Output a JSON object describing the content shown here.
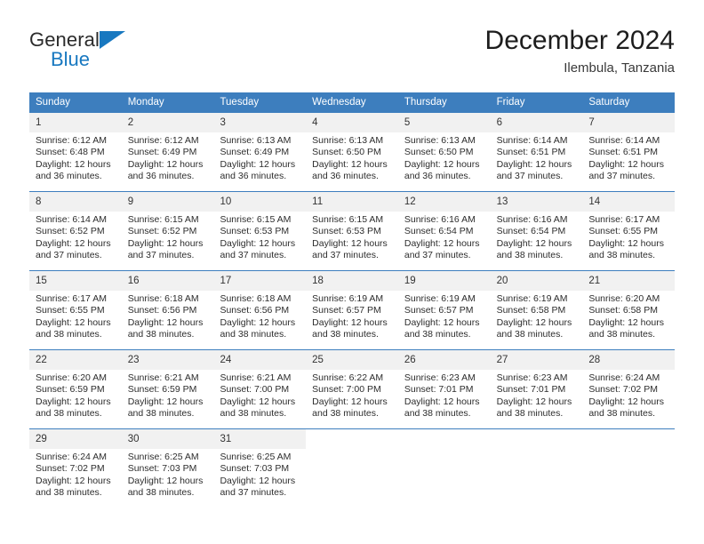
{
  "brand": {
    "name_part1": "General",
    "name_part2": "Blue",
    "accent_color": "#1878c0"
  },
  "header": {
    "title": "December 2024",
    "subtitle": "Ilembula, Tanzania"
  },
  "calendar": {
    "header_color": "#3d7ebe",
    "weekdays": [
      "Sunday",
      "Monday",
      "Tuesday",
      "Wednesday",
      "Thursday",
      "Friday",
      "Saturday"
    ],
    "weeks": [
      [
        {
          "day": "1",
          "sunrise": "Sunrise: 6:12 AM",
          "sunset": "Sunset: 6:48 PM",
          "daylight_line1": "Daylight: 12 hours",
          "daylight_line2": "and 36 minutes."
        },
        {
          "day": "2",
          "sunrise": "Sunrise: 6:12 AM",
          "sunset": "Sunset: 6:49 PM",
          "daylight_line1": "Daylight: 12 hours",
          "daylight_line2": "and 36 minutes."
        },
        {
          "day": "3",
          "sunrise": "Sunrise: 6:13 AM",
          "sunset": "Sunset: 6:49 PM",
          "daylight_line1": "Daylight: 12 hours",
          "daylight_line2": "and 36 minutes."
        },
        {
          "day": "4",
          "sunrise": "Sunrise: 6:13 AM",
          "sunset": "Sunset: 6:50 PM",
          "daylight_line1": "Daylight: 12 hours",
          "daylight_line2": "and 36 minutes."
        },
        {
          "day": "5",
          "sunrise": "Sunrise: 6:13 AM",
          "sunset": "Sunset: 6:50 PM",
          "daylight_line1": "Daylight: 12 hours",
          "daylight_line2": "and 36 minutes."
        },
        {
          "day": "6",
          "sunrise": "Sunrise: 6:14 AM",
          "sunset": "Sunset: 6:51 PM",
          "daylight_line1": "Daylight: 12 hours",
          "daylight_line2": "and 37 minutes."
        },
        {
          "day": "7",
          "sunrise": "Sunrise: 6:14 AM",
          "sunset": "Sunset: 6:51 PM",
          "daylight_line1": "Daylight: 12 hours",
          "daylight_line2": "and 37 minutes."
        }
      ],
      [
        {
          "day": "8",
          "sunrise": "Sunrise: 6:14 AM",
          "sunset": "Sunset: 6:52 PM",
          "daylight_line1": "Daylight: 12 hours",
          "daylight_line2": "and 37 minutes."
        },
        {
          "day": "9",
          "sunrise": "Sunrise: 6:15 AM",
          "sunset": "Sunset: 6:52 PM",
          "daylight_line1": "Daylight: 12 hours",
          "daylight_line2": "and 37 minutes."
        },
        {
          "day": "10",
          "sunrise": "Sunrise: 6:15 AM",
          "sunset": "Sunset: 6:53 PM",
          "daylight_line1": "Daylight: 12 hours",
          "daylight_line2": "and 37 minutes."
        },
        {
          "day": "11",
          "sunrise": "Sunrise: 6:15 AM",
          "sunset": "Sunset: 6:53 PM",
          "daylight_line1": "Daylight: 12 hours",
          "daylight_line2": "and 37 minutes."
        },
        {
          "day": "12",
          "sunrise": "Sunrise: 6:16 AM",
          "sunset": "Sunset: 6:54 PM",
          "daylight_line1": "Daylight: 12 hours",
          "daylight_line2": "and 37 minutes."
        },
        {
          "day": "13",
          "sunrise": "Sunrise: 6:16 AM",
          "sunset": "Sunset: 6:54 PM",
          "daylight_line1": "Daylight: 12 hours",
          "daylight_line2": "and 38 minutes."
        },
        {
          "day": "14",
          "sunrise": "Sunrise: 6:17 AM",
          "sunset": "Sunset: 6:55 PM",
          "daylight_line1": "Daylight: 12 hours",
          "daylight_line2": "and 38 minutes."
        }
      ],
      [
        {
          "day": "15",
          "sunrise": "Sunrise: 6:17 AM",
          "sunset": "Sunset: 6:55 PM",
          "daylight_line1": "Daylight: 12 hours",
          "daylight_line2": "and 38 minutes."
        },
        {
          "day": "16",
          "sunrise": "Sunrise: 6:18 AM",
          "sunset": "Sunset: 6:56 PM",
          "daylight_line1": "Daylight: 12 hours",
          "daylight_line2": "and 38 minutes."
        },
        {
          "day": "17",
          "sunrise": "Sunrise: 6:18 AM",
          "sunset": "Sunset: 6:56 PM",
          "daylight_line1": "Daylight: 12 hours",
          "daylight_line2": "and 38 minutes."
        },
        {
          "day": "18",
          "sunrise": "Sunrise: 6:19 AM",
          "sunset": "Sunset: 6:57 PM",
          "daylight_line1": "Daylight: 12 hours",
          "daylight_line2": "and 38 minutes."
        },
        {
          "day": "19",
          "sunrise": "Sunrise: 6:19 AM",
          "sunset": "Sunset: 6:57 PM",
          "daylight_line1": "Daylight: 12 hours",
          "daylight_line2": "and 38 minutes."
        },
        {
          "day": "20",
          "sunrise": "Sunrise: 6:19 AM",
          "sunset": "Sunset: 6:58 PM",
          "daylight_line1": "Daylight: 12 hours",
          "daylight_line2": "and 38 minutes."
        },
        {
          "day": "21",
          "sunrise": "Sunrise: 6:20 AM",
          "sunset": "Sunset: 6:58 PM",
          "daylight_line1": "Daylight: 12 hours",
          "daylight_line2": "and 38 minutes."
        }
      ],
      [
        {
          "day": "22",
          "sunrise": "Sunrise: 6:20 AM",
          "sunset": "Sunset: 6:59 PM",
          "daylight_line1": "Daylight: 12 hours",
          "daylight_line2": "and 38 minutes."
        },
        {
          "day": "23",
          "sunrise": "Sunrise: 6:21 AM",
          "sunset": "Sunset: 6:59 PM",
          "daylight_line1": "Daylight: 12 hours",
          "daylight_line2": "and 38 minutes."
        },
        {
          "day": "24",
          "sunrise": "Sunrise: 6:21 AM",
          "sunset": "Sunset: 7:00 PM",
          "daylight_line1": "Daylight: 12 hours",
          "daylight_line2": "and 38 minutes."
        },
        {
          "day": "25",
          "sunrise": "Sunrise: 6:22 AM",
          "sunset": "Sunset: 7:00 PM",
          "daylight_line1": "Daylight: 12 hours",
          "daylight_line2": "and 38 minutes."
        },
        {
          "day": "26",
          "sunrise": "Sunrise: 6:23 AM",
          "sunset": "Sunset: 7:01 PM",
          "daylight_line1": "Daylight: 12 hours",
          "daylight_line2": "and 38 minutes."
        },
        {
          "day": "27",
          "sunrise": "Sunrise: 6:23 AM",
          "sunset": "Sunset: 7:01 PM",
          "daylight_line1": "Daylight: 12 hours",
          "daylight_line2": "and 38 minutes."
        },
        {
          "day": "28",
          "sunrise": "Sunrise: 6:24 AM",
          "sunset": "Sunset: 7:02 PM",
          "daylight_line1": "Daylight: 12 hours",
          "daylight_line2": "and 38 minutes."
        }
      ],
      [
        {
          "day": "29",
          "sunrise": "Sunrise: 6:24 AM",
          "sunset": "Sunset: 7:02 PM",
          "daylight_line1": "Daylight: 12 hours",
          "daylight_line2": "and 38 minutes."
        },
        {
          "day": "30",
          "sunrise": "Sunrise: 6:25 AM",
          "sunset": "Sunset: 7:03 PM",
          "daylight_line1": "Daylight: 12 hours",
          "daylight_line2": "and 38 minutes."
        },
        {
          "day": "31",
          "sunrise": "Sunrise: 6:25 AM",
          "sunset": "Sunset: 7:03 PM",
          "daylight_line1": "Daylight: 12 hours",
          "daylight_line2": "and 37 minutes."
        },
        {
          "day": "",
          "sunrise": "",
          "sunset": "",
          "daylight_line1": "",
          "daylight_line2": ""
        },
        {
          "day": "",
          "sunrise": "",
          "sunset": "",
          "daylight_line1": "",
          "daylight_line2": ""
        },
        {
          "day": "",
          "sunrise": "",
          "sunset": "",
          "daylight_line1": "",
          "daylight_line2": ""
        },
        {
          "day": "",
          "sunrise": "",
          "sunset": "",
          "daylight_line1": "",
          "daylight_line2": ""
        }
      ]
    ]
  }
}
